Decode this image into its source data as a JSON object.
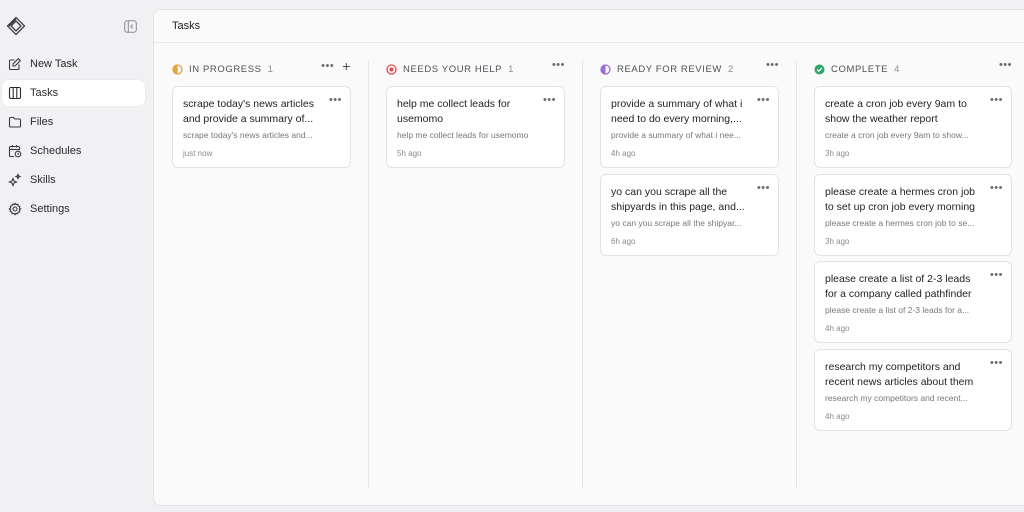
{
  "sidebar": {
    "items": [
      {
        "label": "New Task",
        "icon": "edit-icon"
      },
      {
        "label": "Tasks",
        "icon": "columns-icon"
      },
      {
        "label": "Files",
        "icon": "folder-icon"
      },
      {
        "label": "Schedules",
        "icon": "calendar-clock-icon"
      },
      {
        "label": "Skills",
        "icon": "sparkles-icon"
      },
      {
        "label": "Settings",
        "icon": "gear-icon"
      }
    ]
  },
  "header": {
    "title": "Tasks"
  },
  "columns": [
    {
      "title": "IN PROGRESS",
      "count": "1",
      "status_color": "#e3a33b",
      "cards": [
        {
          "title": "scrape today's news articles and provide a summary of...",
          "subtitle": "scrape today's news articles and...",
          "time": "just now"
        }
      ]
    },
    {
      "title": "NEEDS YOUR HELP",
      "count": "1",
      "status_color": "#e5484d",
      "cards": [
        {
          "title": "help me collect leads for usemomo",
          "subtitle": "help me collect leads for usemomo",
          "time": "5h ago"
        }
      ]
    },
    {
      "title": "READY FOR REVIEW",
      "count": "2",
      "status_color": "#9b6bdb",
      "cards": [
        {
          "title": "provide a summary of what i need to do every morning,...",
          "subtitle": "provide a summary of what i nee...",
          "time": "4h ago"
        },
        {
          "title": "yo can you scrape all the shipyards in this page, and...",
          "subtitle": "yo can you scrape all the shipyar...",
          "time": "6h ago"
        }
      ]
    },
    {
      "title": "COMPLETE",
      "count": "4",
      "status_color": "#2ea36a",
      "cards": [
        {
          "title": "create a cron job every 9am to show the weather report",
          "subtitle": "create a cron job every 9am to show...",
          "time": "3h ago"
        },
        {
          "title": "please create a hermes cron job to set up cron job every morning",
          "subtitle": "please create a hermes cron job to se...",
          "time": "3h ago"
        },
        {
          "title": "please create a list of 2-3 leads for a company called pathfinder",
          "subtitle": "please create a list of 2-3 leads for a...",
          "time": "4h ago"
        },
        {
          "title": "research my competitors and recent news articles about them",
          "subtitle": "research my competitors and recent...",
          "time": "4h ago"
        }
      ]
    }
  ]
}
